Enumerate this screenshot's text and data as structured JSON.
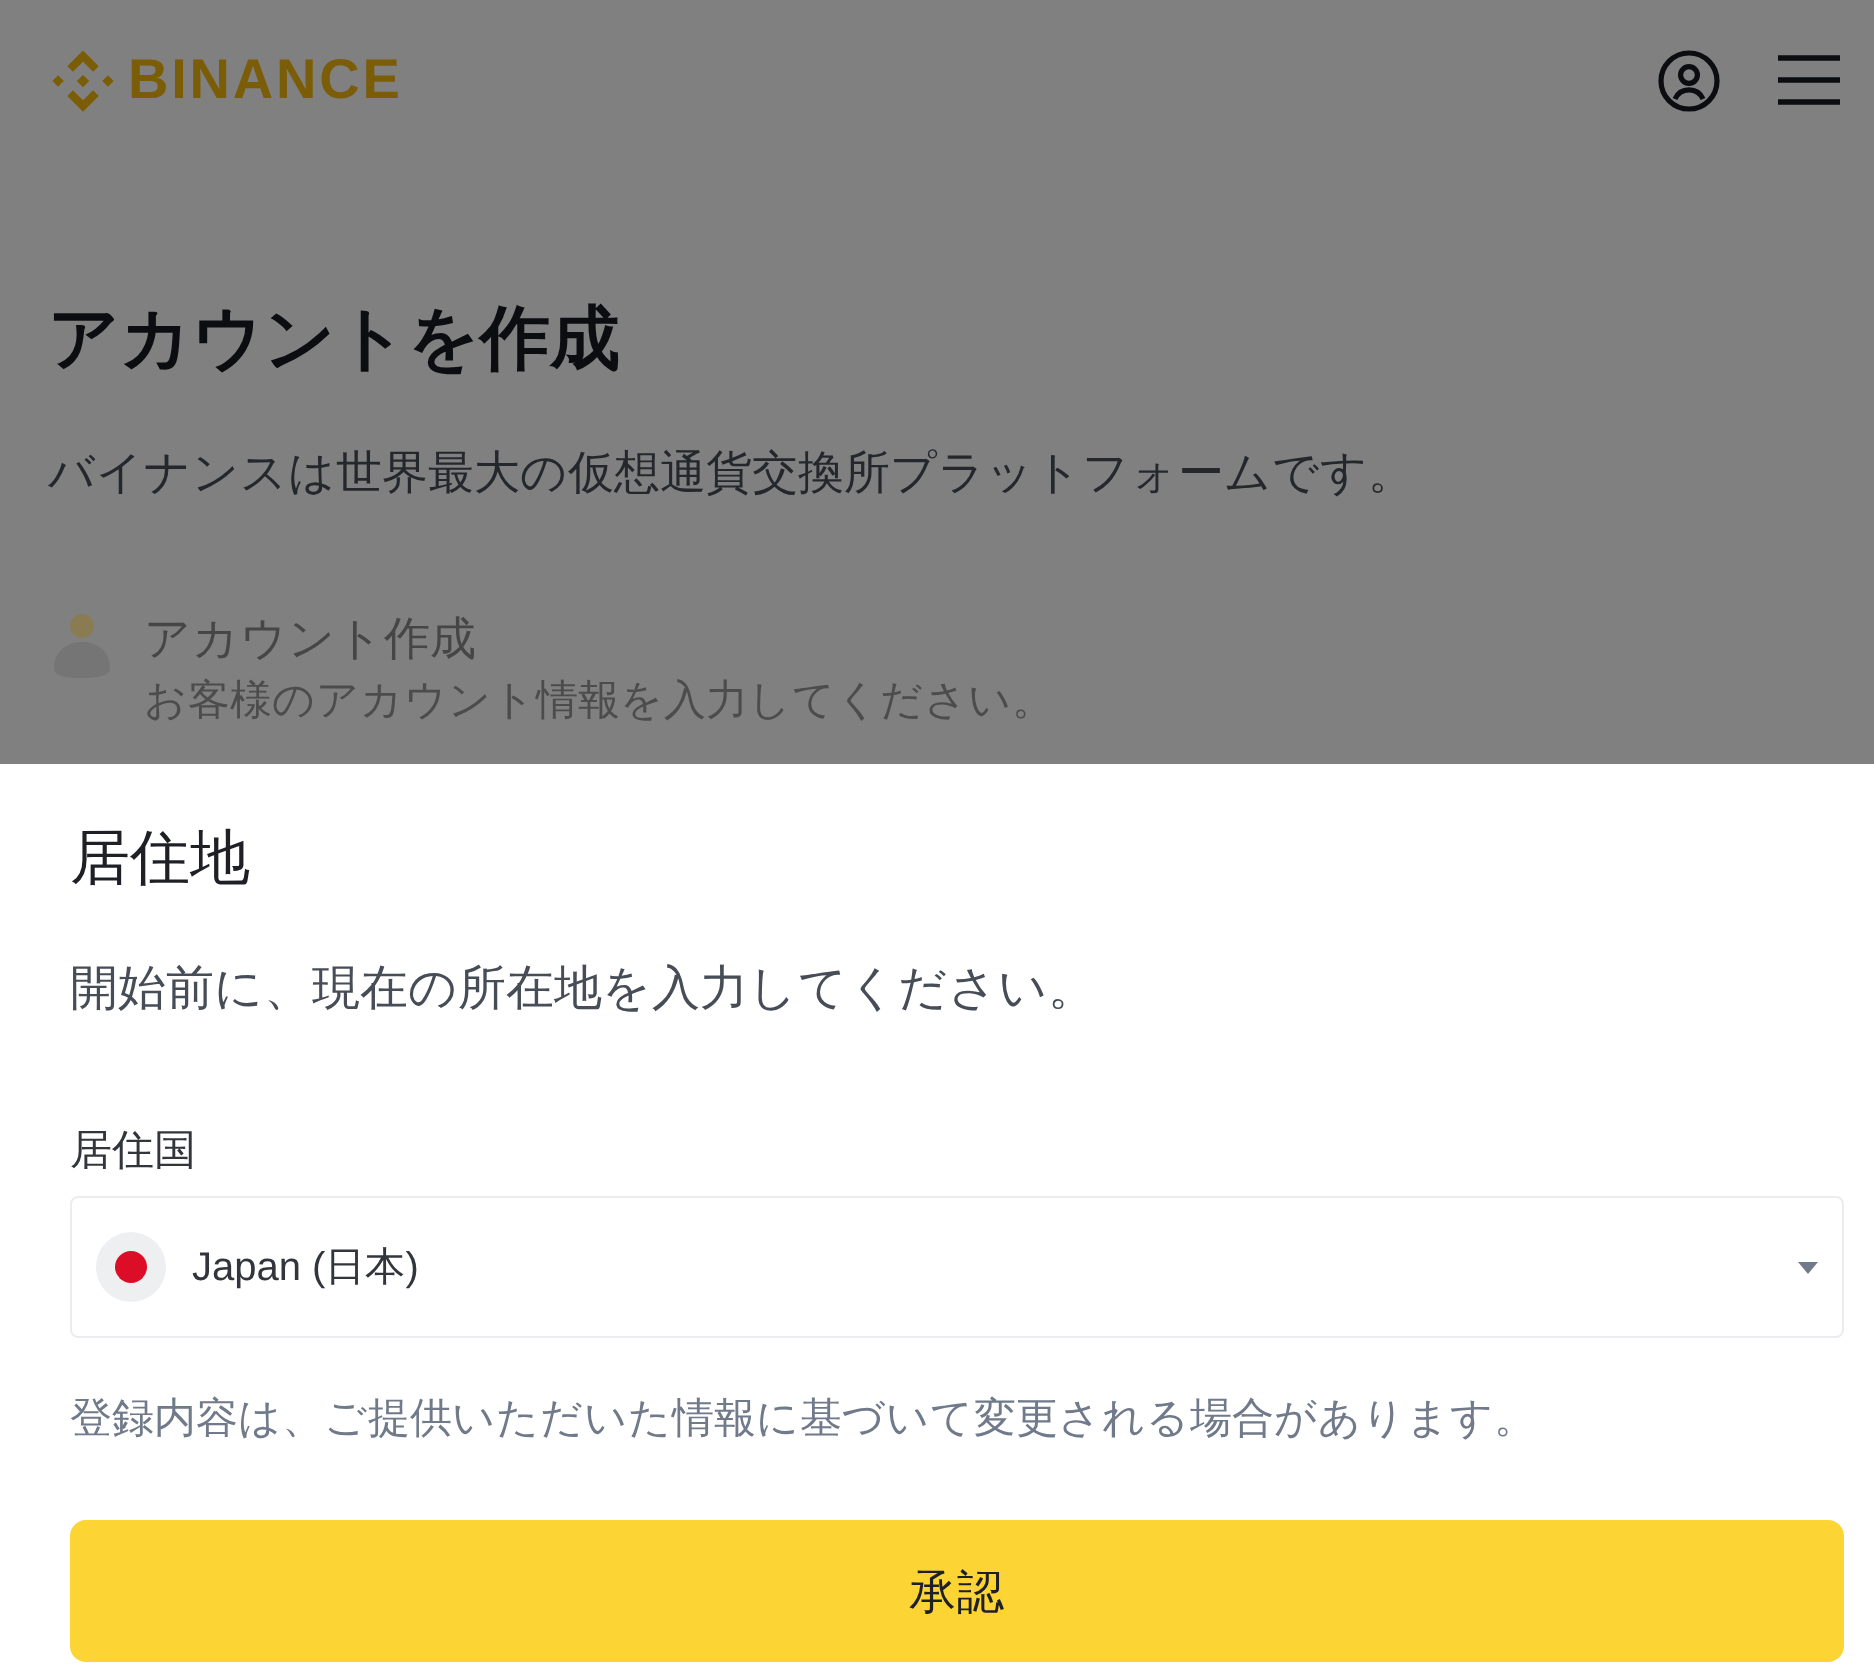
{
  "header": {
    "logo": "BINANCE"
  },
  "intro": {
    "title": "アカウントを作成",
    "subtitle": "バイナンスは世界最大の仮想通貨交換所プラットフォームです。",
    "steps": [
      {
        "title": "アカウント作成",
        "description": "お客様のアカウント情報を入力してください。"
      }
    ]
  },
  "residence_sheet": {
    "title": "居住地",
    "description": "開始前に、現在の所在地を入力してください。",
    "country_label": "居住国",
    "country_select": {
      "value": "Japan (日本)"
    },
    "note": "登録内容は、ご提供いただいた情報に基づいて変更される場合があります。",
    "confirm_button": "承認"
  }
}
